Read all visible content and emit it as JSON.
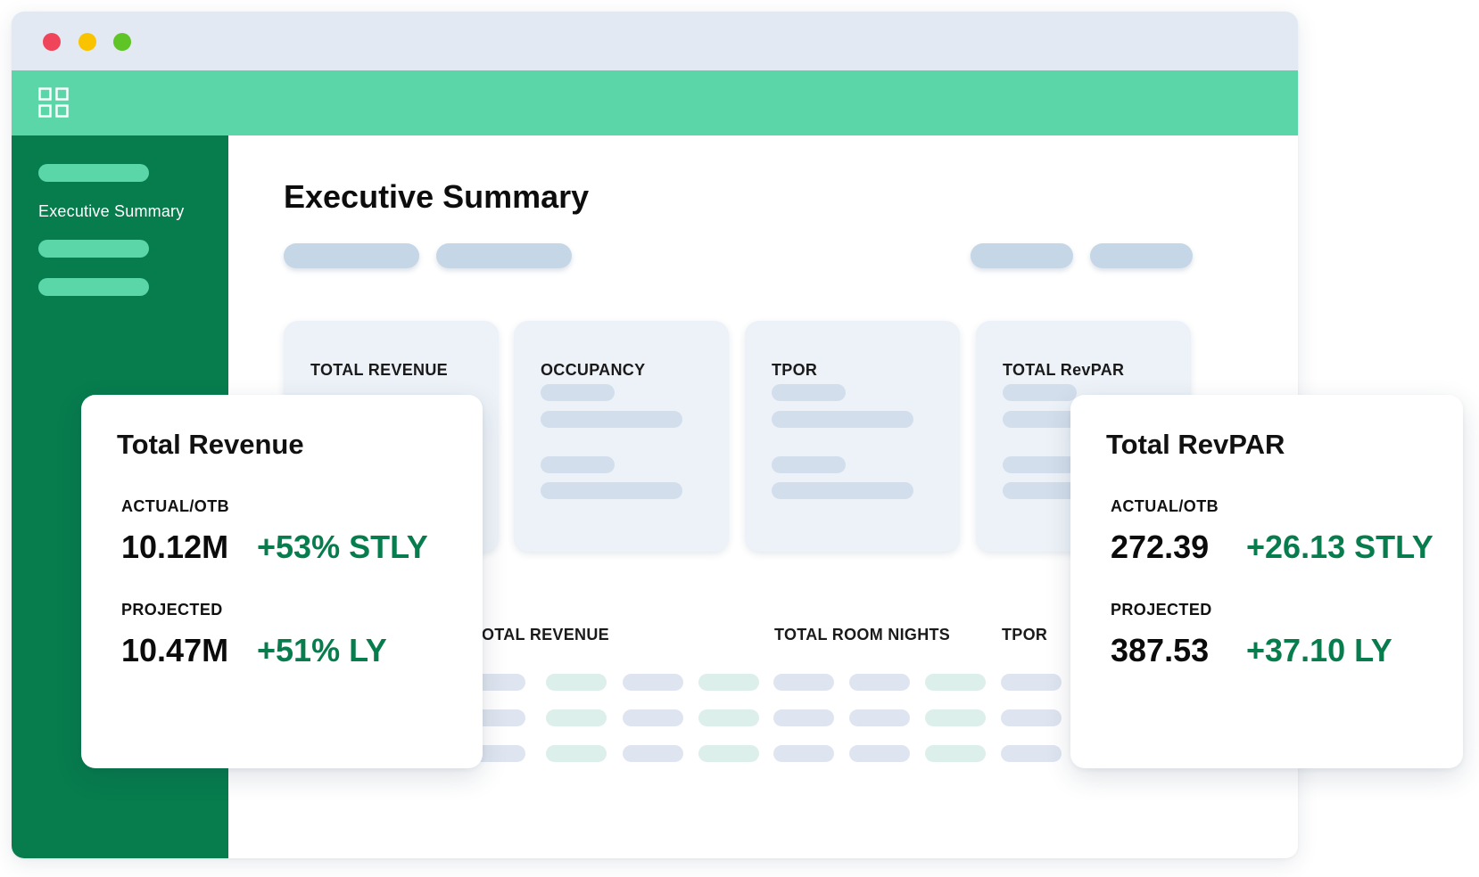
{
  "sidebar": {
    "active_label": "Executive Summary"
  },
  "page": {
    "title": "Executive Summary"
  },
  "kpi_cards": [
    {
      "title": "TOTAL REVENUE"
    },
    {
      "title": "OCCUPANCY"
    },
    {
      "title": "TPOR"
    },
    {
      "title": "TOTAL RevPAR"
    }
  ],
  "table": {
    "headers": [
      "OTAL REVENUE",
      "TOTAL ROOM NIGHTS",
      "TPOR"
    ]
  },
  "revenue_card": {
    "title": "Total Revenue",
    "actual_label": "ACTUAL/OTB",
    "actual_value": "10.12M",
    "actual_delta": "+53% STLY",
    "projected_label": "PROJECTED",
    "projected_value": "10.47M",
    "projected_delta": "+51% LY"
  },
  "revpar_card": {
    "title": "Total RevPAR",
    "actual_label": "ACTUAL/OTB",
    "actual_value": "272.39",
    "actual_delta": "+26.13 STLY",
    "projected_label": "PROJECTED",
    "projected_value": "387.53",
    "projected_delta": "+37.10 LY"
  },
  "colors": {
    "brand_dark_green": "#077c4d",
    "brand_mint": "#5ad6a8",
    "delta_green": "#077c4d",
    "placeholder_blue": "#c5d6e6"
  },
  "icons": [
    "apps-grid-icon"
  ]
}
